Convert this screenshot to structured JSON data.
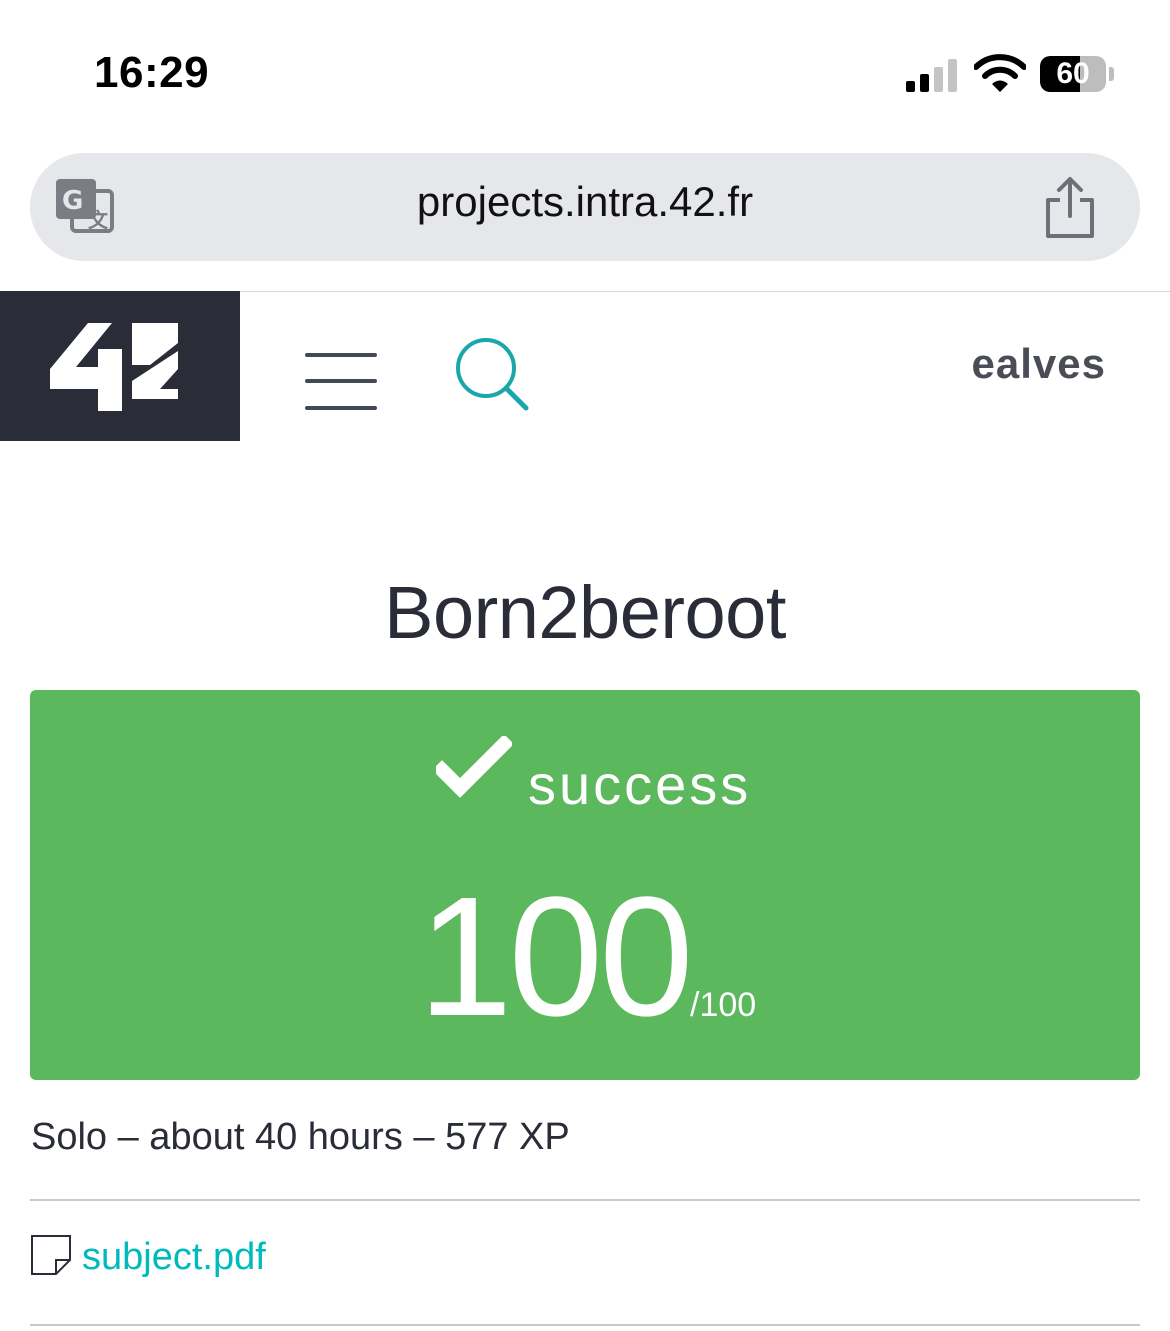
{
  "status_bar": {
    "time": "16:29",
    "battery_percent": "60",
    "battery_level": 0.6,
    "signal_bars_active": 2,
    "signal_bars_total": 4
  },
  "browser": {
    "url": "projects.intra.42.fr",
    "translate_icon": "translate-icon",
    "share_icon": "share-icon"
  },
  "header": {
    "logo": "42",
    "menu_icon": "hamburger-menu-icon",
    "search_icon": "search-icon",
    "username": "ealves"
  },
  "project": {
    "title": "Born2beroot",
    "status": "success",
    "score": "100",
    "score_max": "/100",
    "meta": "Solo – about 40 hours – 577 XP",
    "attachment": "subject.pdf"
  },
  "colors": {
    "success_green": "#5cb85c",
    "brand_dark": "#2a2d38",
    "link_teal": "#00babc",
    "search_teal": "#1aa7a9"
  }
}
